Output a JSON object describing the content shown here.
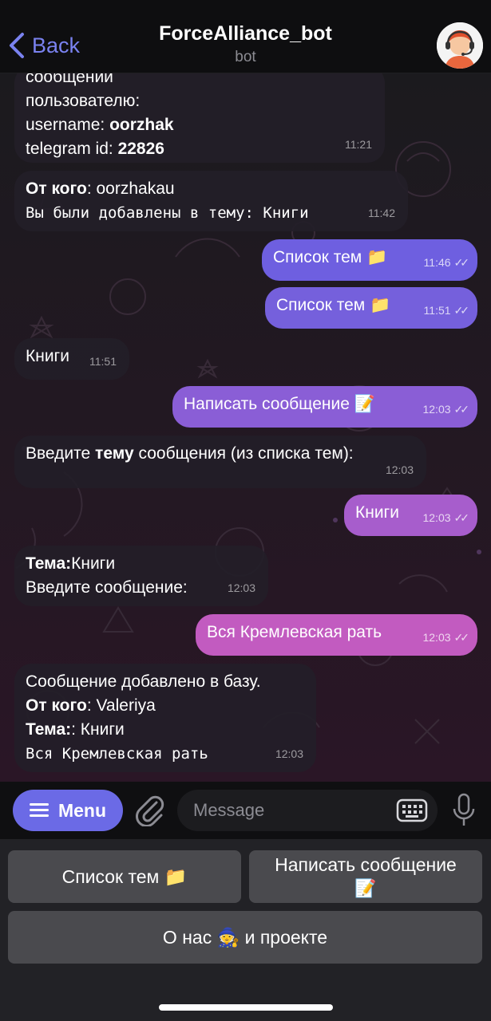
{
  "header": {
    "back_label": "Back",
    "title": "ForceAlliance_bot",
    "subtitle": "bot"
  },
  "messages": [
    {
      "dir": "in",
      "line1": "сообщении",
      "line2": "пользователю:",
      "username_label": "username: ",
      "username": "oorzhak",
      "tgid_label": "telegram id: ",
      "tgid": "22826",
      "time": "11:21"
    },
    {
      "dir": "in",
      "from_label": "От кого",
      "from_value": ": oorzhakau",
      "line2": "Вы были добавлены в тему: Книги",
      "time": "11:42"
    },
    {
      "dir": "out",
      "text": "Список тем 📁",
      "time": "11:46"
    },
    {
      "dir": "out",
      "text": "Список тем 📁",
      "time": "11:51"
    },
    {
      "dir": "in",
      "text": "Книги",
      "time": "11:51"
    },
    {
      "dir": "out",
      "text": "Написать сообщение 📝",
      "time": "12:03"
    },
    {
      "dir": "in",
      "pre": "Введите ",
      "bold": "тему",
      "post": " сообщения (из списка тем):",
      "time": "12:03"
    },
    {
      "dir": "out",
      "text": "Книги",
      "time": "12:03"
    },
    {
      "dir": "in",
      "bold": "Тема:",
      "rest": "Книги",
      "line2": "Введите сообщение:",
      "time": "12:03"
    },
    {
      "dir": "out",
      "text": "Вся Кремлевская рать",
      "time": "12:03"
    },
    {
      "dir": "in",
      "line1": "Сообщение добавлено в базу.",
      "from_label": "От кого",
      "from_value": ": Valeriya",
      "topic_label": "Тема:",
      "topic_value": ": Книги",
      "line4": "Вся Кремлевская рать",
      "time": "12:03"
    }
  ],
  "input_bar": {
    "menu_label": "Menu",
    "placeholder": "Message"
  },
  "keyboard": {
    "btn1": "Список тем 📁",
    "btn2_line1": "Написать сообщение",
    "btn2_line2": "📝",
    "btn3": "О нас 🧙 и проекте"
  },
  "colors": {
    "accent": "#6b6ae6",
    "back_link": "#7a82f0",
    "incoming_bubble": "#231e28",
    "outgoing_top": "#6b5fe0",
    "outgoing_bottom": "#c45bbf"
  }
}
